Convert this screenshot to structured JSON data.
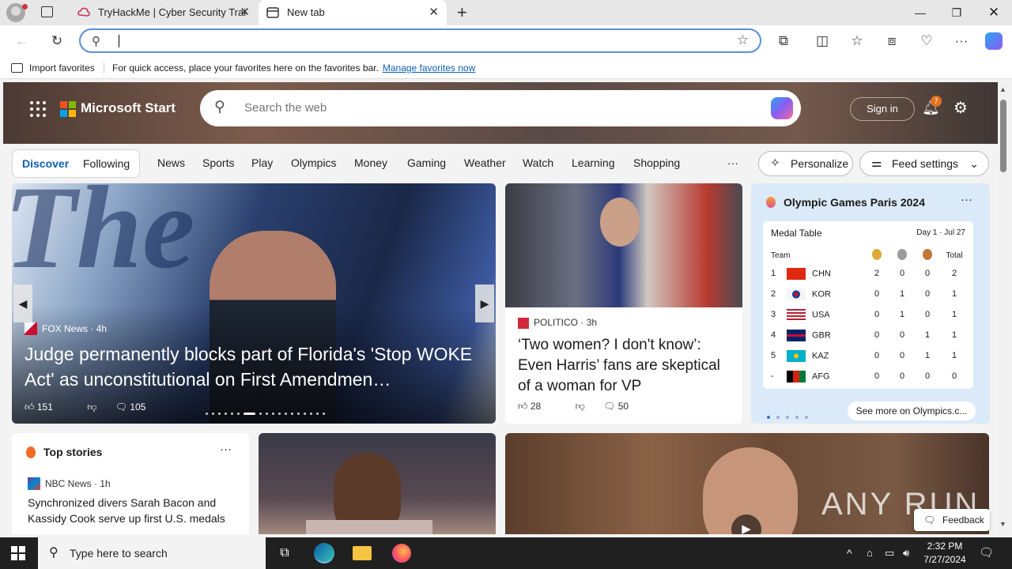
{
  "browser": {
    "tabs": [
      {
        "title": "TryHackMe | Cyber Security Trai"
      },
      {
        "title": "New tab"
      }
    ],
    "address": {
      "value": "",
      "placeholder": ""
    },
    "favorites_bar": {
      "import_label": "Import favorites",
      "message": "For quick access, place your favorites here on the favorites bar.",
      "link": "Manage favorites now"
    }
  },
  "start": {
    "brand": "Microsoft Start",
    "search_placeholder": "Search the web",
    "sign_in": "Sign in",
    "notification_count": "7",
    "nav": {
      "discover": "Discover",
      "following": "Following",
      "items": [
        "News",
        "Sports",
        "Play",
        "Olympics",
        "Money",
        "Gaming",
        "Weather",
        "Watch",
        "Learning",
        "Shopping"
      ],
      "more": "···",
      "personalize": "Personalize",
      "feed_settings": "Feed settings"
    },
    "hero": {
      "source": "FOX News",
      "age": "4h",
      "headline": "Judge permanently blocks part of Florida's 'Stop WOKE Act' as unconstitutional on First Amendmen…",
      "likes": "151",
      "comments": "105"
    },
    "card2": {
      "source": "POLITICO",
      "age": "3h",
      "headline": "‘Two women? I don't know’: Even Harris’ fans are skeptical of a woman for VP",
      "likes": "28",
      "comments": "50"
    },
    "olympics": {
      "title": "Olympic Games Paris 2024",
      "table_title": "Medal Table",
      "date": "Day 1 · Jul 27",
      "col_team": "Team",
      "col_total": "Total",
      "rows": [
        {
          "rank": "1",
          "team": "CHN",
          "gold": "2",
          "silver": "0",
          "bronze": "0",
          "total": "2"
        },
        {
          "rank": "2",
          "team": "KOR",
          "gold": "0",
          "silver": "1",
          "bronze": "0",
          "total": "1"
        },
        {
          "rank": "3",
          "team": "USA",
          "gold": "0",
          "silver": "1",
          "bronze": "0",
          "total": "1"
        },
        {
          "rank": "4",
          "team": "GBR",
          "gold": "0",
          "silver": "0",
          "bronze": "1",
          "total": "1"
        },
        {
          "rank": "5",
          "team": "KAZ",
          "gold": "0",
          "silver": "0",
          "bronze": "1",
          "total": "1"
        },
        {
          "rank": "-",
          "team": "AFG",
          "gold": "0",
          "silver": "0",
          "bronze": "0",
          "total": "0"
        }
      ],
      "see_more": "See more on Olympics.c..."
    },
    "top_stories": {
      "title": "Top stories",
      "source": "NBC News",
      "age": "1h",
      "headline": "Synchronized divers Sarah Bacon and Kassidy Cook serve up first U.S. medals"
    },
    "feedback": "Feedback",
    "watermark": "ANY RUN"
  },
  "taskbar": {
    "search_placeholder": "Type here to search",
    "time": "2:32 PM",
    "date": "7/27/2024"
  }
}
